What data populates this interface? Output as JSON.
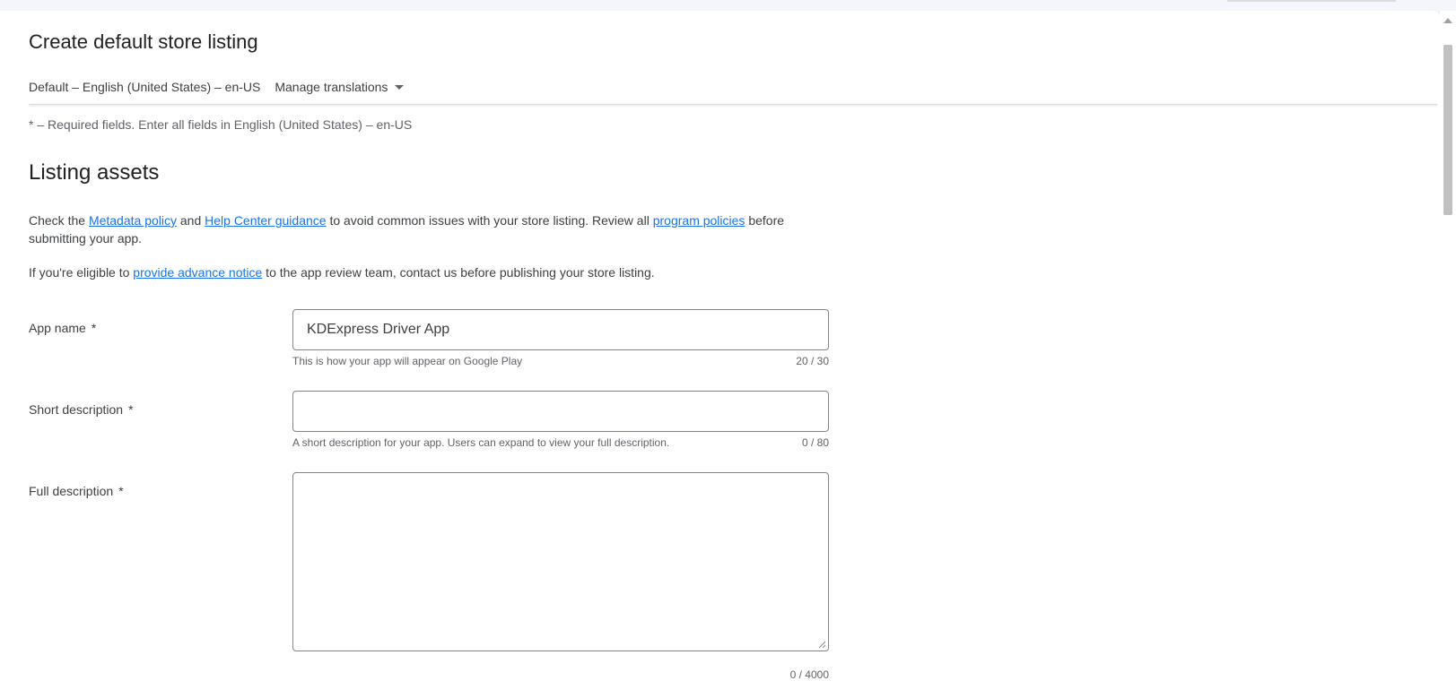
{
  "page": {
    "title": "Create default store listing",
    "language_label": "Default – English (United States) – en-US",
    "manage_translations_label": "Manage translations",
    "required_note": "* – Required fields. Enter all fields in English (United States) – en-US"
  },
  "section": {
    "title": "Listing assets",
    "para1": {
      "prefix": "Check the ",
      "link_metadata": "Metadata policy",
      "mid1": " and ",
      "link_help": "Help Center guidance",
      "mid2": " to avoid common issues with your store listing. Review all ",
      "link_policies": "program policies",
      "suffix": " before submitting your app."
    },
    "para2": {
      "prefix": "If you're eligible to ",
      "link_notice": "provide advance notice",
      "suffix": " to the app review team, contact us before publishing your store listing."
    }
  },
  "fields": {
    "app_name": {
      "label": "App name",
      "required_mark": "*",
      "value": "KDExpress Driver App",
      "hint": "This is how your app will appear on Google Play",
      "counter": "20 / 30"
    },
    "short_description": {
      "label": "Short description",
      "required_mark": "*",
      "value": "",
      "hint": "A short description for your app. Users can expand to view your full description.",
      "counter": "0 / 80"
    },
    "full_description": {
      "label": "Full description",
      "required_mark": "*",
      "value": "",
      "counter": "0 / 4000"
    }
  },
  "colors": {
    "link": "#1a73e8",
    "text": "#202124",
    "secondary_text": "#5f6368",
    "border": "#80868b"
  },
  "icons": {
    "manage_translations_caret": "caret-down-icon",
    "scroll_up": "scroll-up-arrow-icon",
    "resize": "resize-grip-icon"
  }
}
